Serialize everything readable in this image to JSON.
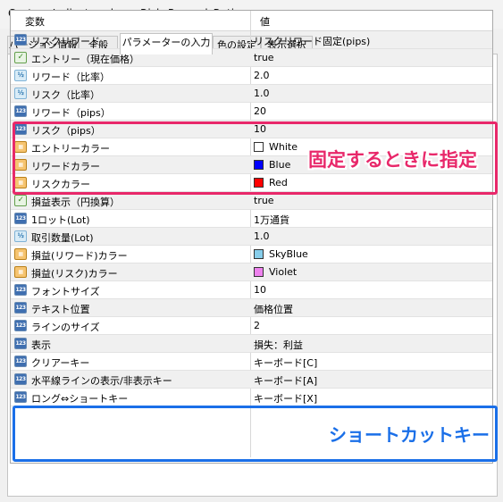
{
  "window": {
    "title": "Custom Indicator - keys_Risk_Reward_Ratio"
  },
  "tabs": [
    {
      "label": "バージョン情報"
    },
    {
      "label": "全般"
    },
    {
      "label": "パラメーターの入力"
    },
    {
      "label": "色の設定"
    },
    {
      "label": "表示選択"
    }
  ],
  "grid": {
    "header_variable": "変数",
    "header_value": "値",
    "rows": [
      {
        "icon": "123",
        "label": "リスクリワード",
        "value": "リスクリワード固定(pips)"
      },
      {
        "icon": "bool",
        "label": "エントリー（現在価格）",
        "value": "true"
      },
      {
        "icon": "frac",
        "label": "リワード（比率）",
        "value": "2.0"
      },
      {
        "icon": "frac",
        "label": "リスク（比率）",
        "value": "1.0"
      },
      {
        "icon": "123",
        "label": "リワード（pips）",
        "value": "20"
      },
      {
        "icon": "123",
        "label": "リスク（pips）",
        "value": "10"
      },
      {
        "icon": "color",
        "label": "エントリーカラー",
        "value": "White",
        "swatch": "#ffffff"
      },
      {
        "icon": "color",
        "label": "リワードカラー",
        "value": "Blue",
        "swatch": "#0000ff"
      },
      {
        "icon": "color",
        "label": "リスクカラー",
        "value": "Red",
        "swatch": "#ff0000"
      },
      {
        "icon": "bool",
        "label": "損益表示（円換算）",
        "value": "true"
      },
      {
        "icon": "123",
        "label": "1ロット(Lot)",
        "value": "1万通貨"
      },
      {
        "icon": "frac",
        "label": "取引数量(Lot)",
        "value": "1.0"
      },
      {
        "icon": "color",
        "label": "損益(リワード)カラー",
        "value": "SkyBlue",
        "swatch": "#87ceeb"
      },
      {
        "icon": "color",
        "label": "損益(リスク)カラー",
        "value": "Violet",
        "swatch": "#ee82ee"
      },
      {
        "icon": "123",
        "label": "フォントサイズ",
        "value": "10"
      },
      {
        "icon": "123",
        "label": "テキスト位置",
        "value": "価格位置"
      },
      {
        "icon": "123",
        "label": "ラインのサイズ",
        "value": "2"
      },
      {
        "icon": "123",
        "label": "表示",
        "value": "損失：利益"
      },
      {
        "icon": "123",
        "label": "クリアーキー",
        "value": "キーボード[C]"
      },
      {
        "icon": "123",
        "label": "水平線ラインの表示/非表示キー",
        "value": "キーボード[A]"
      },
      {
        "icon": "123",
        "label": "ロング⇔ショートキー",
        "value": "キーボード[X]"
      }
    ]
  },
  "annotations": {
    "fixed_label": "固定するときに指定",
    "shortcut_label": "ショートカットキー"
  },
  "icon_text": {
    "num": "123",
    "frac": "½",
    "bool": "✓",
    "color": "▦"
  },
  "colors": {
    "pink_highlight": "#e8286a",
    "blue_highlight": "#1a6fe8"
  }
}
